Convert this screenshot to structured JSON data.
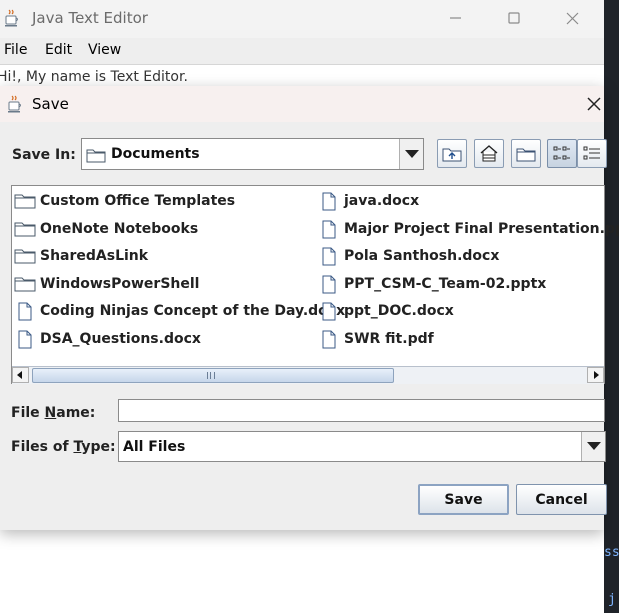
{
  "main_window": {
    "title": "Java Text Editor",
    "menu": [
      "File",
      "Edit",
      "View"
    ],
    "editor_text": "Hi!, My name is Text Editor."
  },
  "background": {
    "code_fragment_1": "ss",
    "code_fragment_2": "j"
  },
  "dialog": {
    "title": "Save",
    "save_in_label": "Save In:",
    "save_in_value": "Documents",
    "file_name_label": "File Name:",
    "file_name_value": "",
    "files_of_type_label": "Files of Type:",
    "files_of_type_value": "All Files",
    "save_button": "Save",
    "cancel_button": "Cancel",
    "toolbar": [
      "up-one-level-icon",
      "home-icon",
      "new-folder-icon",
      "list-view-icon",
      "details-view-icon"
    ],
    "files": [
      {
        "name": "Custom Office Templates",
        "type": "folder"
      },
      {
        "name": "OneNote Notebooks",
        "type": "folder"
      },
      {
        "name": "SharedAsLink",
        "type": "folder"
      },
      {
        "name": "WindowsPowerShell",
        "type": "folder"
      },
      {
        "name": "Coding Ninjas Concept of the Day.docx",
        "type": "file"
      },
      {
        "name": "DSA_Questions.docx",
        "type": "file"
      },
      {
        "name": "java.docx",
        "type": "file"
      },
      {
        "name": "Major Project  Final Presentation.pptx",
        "type": "file"
      },
      {
        "name": "Pola Santhosh.docx",
        "type": "file"
      },
      {
        "name": "PPT_CSM-C_Team-02.pptx",
        "type": "file"
      },
      {
        "name": "ppt_DOC.docx",
        "type": "file"
      },
      {
        "name": "SWR fit.pdf",
        "type": "file"
      }
    ],
    "horizontal_scroll_fraction": 0.0
  }
}
